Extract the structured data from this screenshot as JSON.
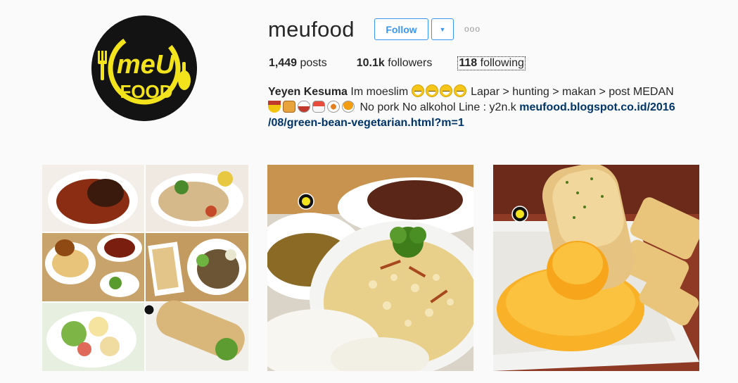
{
  "profile": {
    "username": "meufood",
    "avatar_icon": "meufood-logo",
    "logo_text_top": "meU",
    "logo_text_bottom": "FOOD"
  },
  "actions": {
    "follow_label": "Follow",
    "dropdown_icon": "caret-down-icon",
    "more_label": "ooo"
  },
  "stats": {
    "posts_count": "1,449",
    "posts_label": "posts",
    "followers_count": "10.1k",
    "followers_label": "followers",
    "following_count": "118",
    "following_label": "following"
  },
  "bio": {
    "name": "Yeyen Kesuma",
    "text1": "Im moeslim",
    "text2": "Lapar > hunting > makan > post MEDAN",
    "text3": "No pork No alkohol Line : y2n.k",
    "link_line1": "meufood.blogspot.co.id/2016",
    "link_line2": "/08/green-bean-vegetarian.html?m=1"
  },
  "posts": [
    {
      "label": "collage of curry dishes, noodles, salad and wrap"
    },
    {
      "label": "rice with crackers, soup and beef"
    },
    {
      "label": "garlic bread dipped in cheese sauce"
    }
  ],
  "colors": {
    "accent": "#3897f0",
    "link": "#003569",
    "logo_yellow": "#f2e31c"
  }
}
